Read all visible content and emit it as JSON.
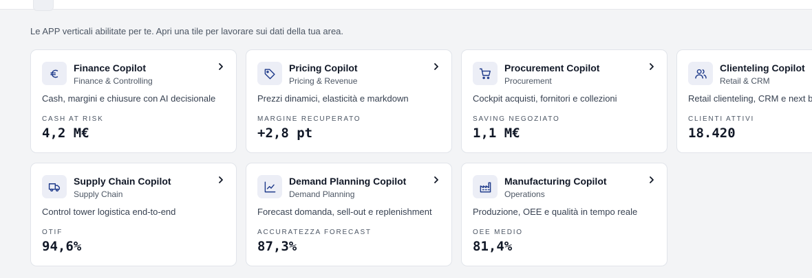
{
  "intro": "Le APP verticali abilitate per te. Apri una tile per lavorare sui dati della tua area.",
  "colors": {
    "accent": "#1e3a8a",
    "icon_bg": "#eceef6",
    "card_border": "#e1e4ea",
    "page_bg": "#f3f4f6"
  },
  "apps": [
    {
      "title": "Finance Copilot",
      "area": "Finance & Controlling",
      "description": "Cash, margini e chiusure con AI decisionale",
      "kpi_label": "CASH AT RISK",
      "kpi_value": "4,2 M€",
      "icon": "euro-icon"
    },
    {
      "title": "Pricing Copilot",
      "area": "Pricing & Revenue",
      "description": "Prezzi dinamici, elasticità e markdown",
      "kpi_label": "MARGINE RECUPERATO",
      "kpi_value": "+2,8 pt",
      "icon": "tag-icon"
    },
    {
      "title": "Procurement Copilot",
      "area": "Procurement",
      "description": "Cockpit acquisti, fornitori e collezioni",
      "kpi_label": "SAVING NEGOZIATO",
      "kpi_value": "1,1 M€",
      "icon": "cart-icon"
    },
    {
      "title": "Clienteling Copilot",
      "area": "Retail & CRM",
      "description": "Retail clienteling, CRM e next be",
      "kpi_label": "CLIENTI ATTIVI",
      "kpi_value": "18.420",
      "icon": "users-icon"
    },
    {
      "title": "Supply Chain Copilot",
      "area": "Supply Chain",
      "description": "Control tower logistica end-to-end",
      "kpi_label": "OTIF",
      "kpi_value": "94,6%",
      "icon": "truck-icon"
    },
    {
      "title": "Demand Planning Copilot",
      "area": "Demand Planning",
      "description": "Forecast domanda, sell-out e replenishment",
      "kpi_label": "ACCURATEZZA FORECAST",
      "kpi_value": "87,3%",
      "icon": "trend-chart-icon"
    },
    {
      "title": "Manufacturing Copilot",
      "area": "Operations",
      "description": "Produzione, OEE e qualità in tempo reale",
      "kpi_label": "OEE MEDIO",
      "kpi_value": "81,4%",
      "icon": "factory-icon"
    }
  ]
}
